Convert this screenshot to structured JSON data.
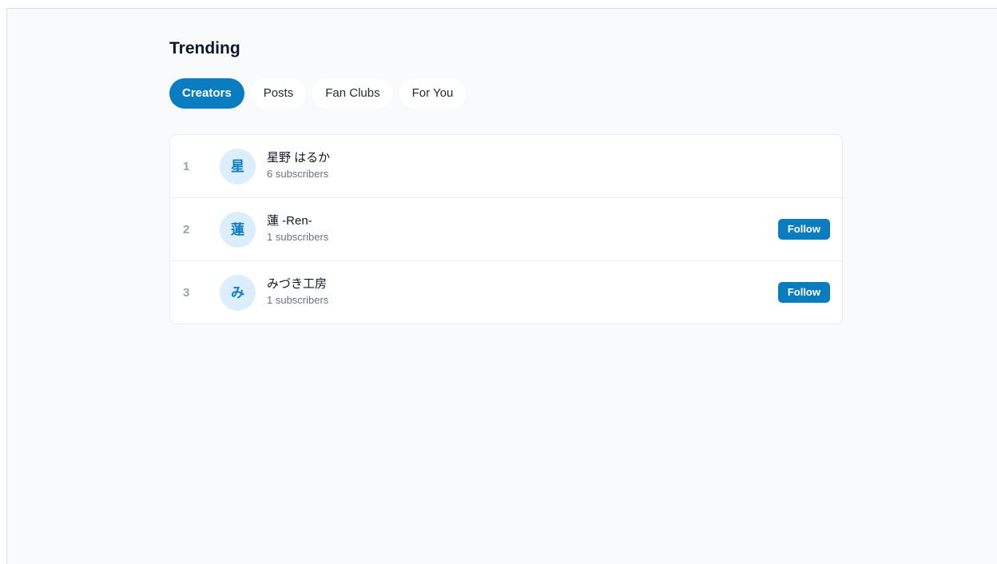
{
  "page": {
    "title": "Trending"
  },
  "tabs": [
    {
      "label": "Creators",
      "active": true
    },
    {
      "label": "Posts",
      "active": false
    },
    {
      "label": "Fan Clubs",
      "active": false
    },
    {
      "label": "For You",
      "active": false
    }
  ],
  "creators": [
    {
      "rank": "1",
      "avatar_text": "星",
      "name": "星野 はるか",
      "subscribers": "6 subscribers",
      "follow_label": ""
    },
    {
      "rank": "2",
      "avatar_text": "蓮",
      "name": "蓮 -Ren-",
      "subscribers": "1 subscribers",
      "follow_label": "Follow"
    },
    {
      "rank": "3",
      "avatar_text": "み",
      "name": "みづき工房",
      "subscribers": "1 subscribers",
      "follow_label": "Follow"
    }
  ],
  "colors": {
    "accent": "#0a7dc1",
    "page_background": "#f8fafc",
    "avatar_background": "#dceefb",
    "rank_text": "#94a3b8",
    "muted_text": "#6b7280"
  }
}
